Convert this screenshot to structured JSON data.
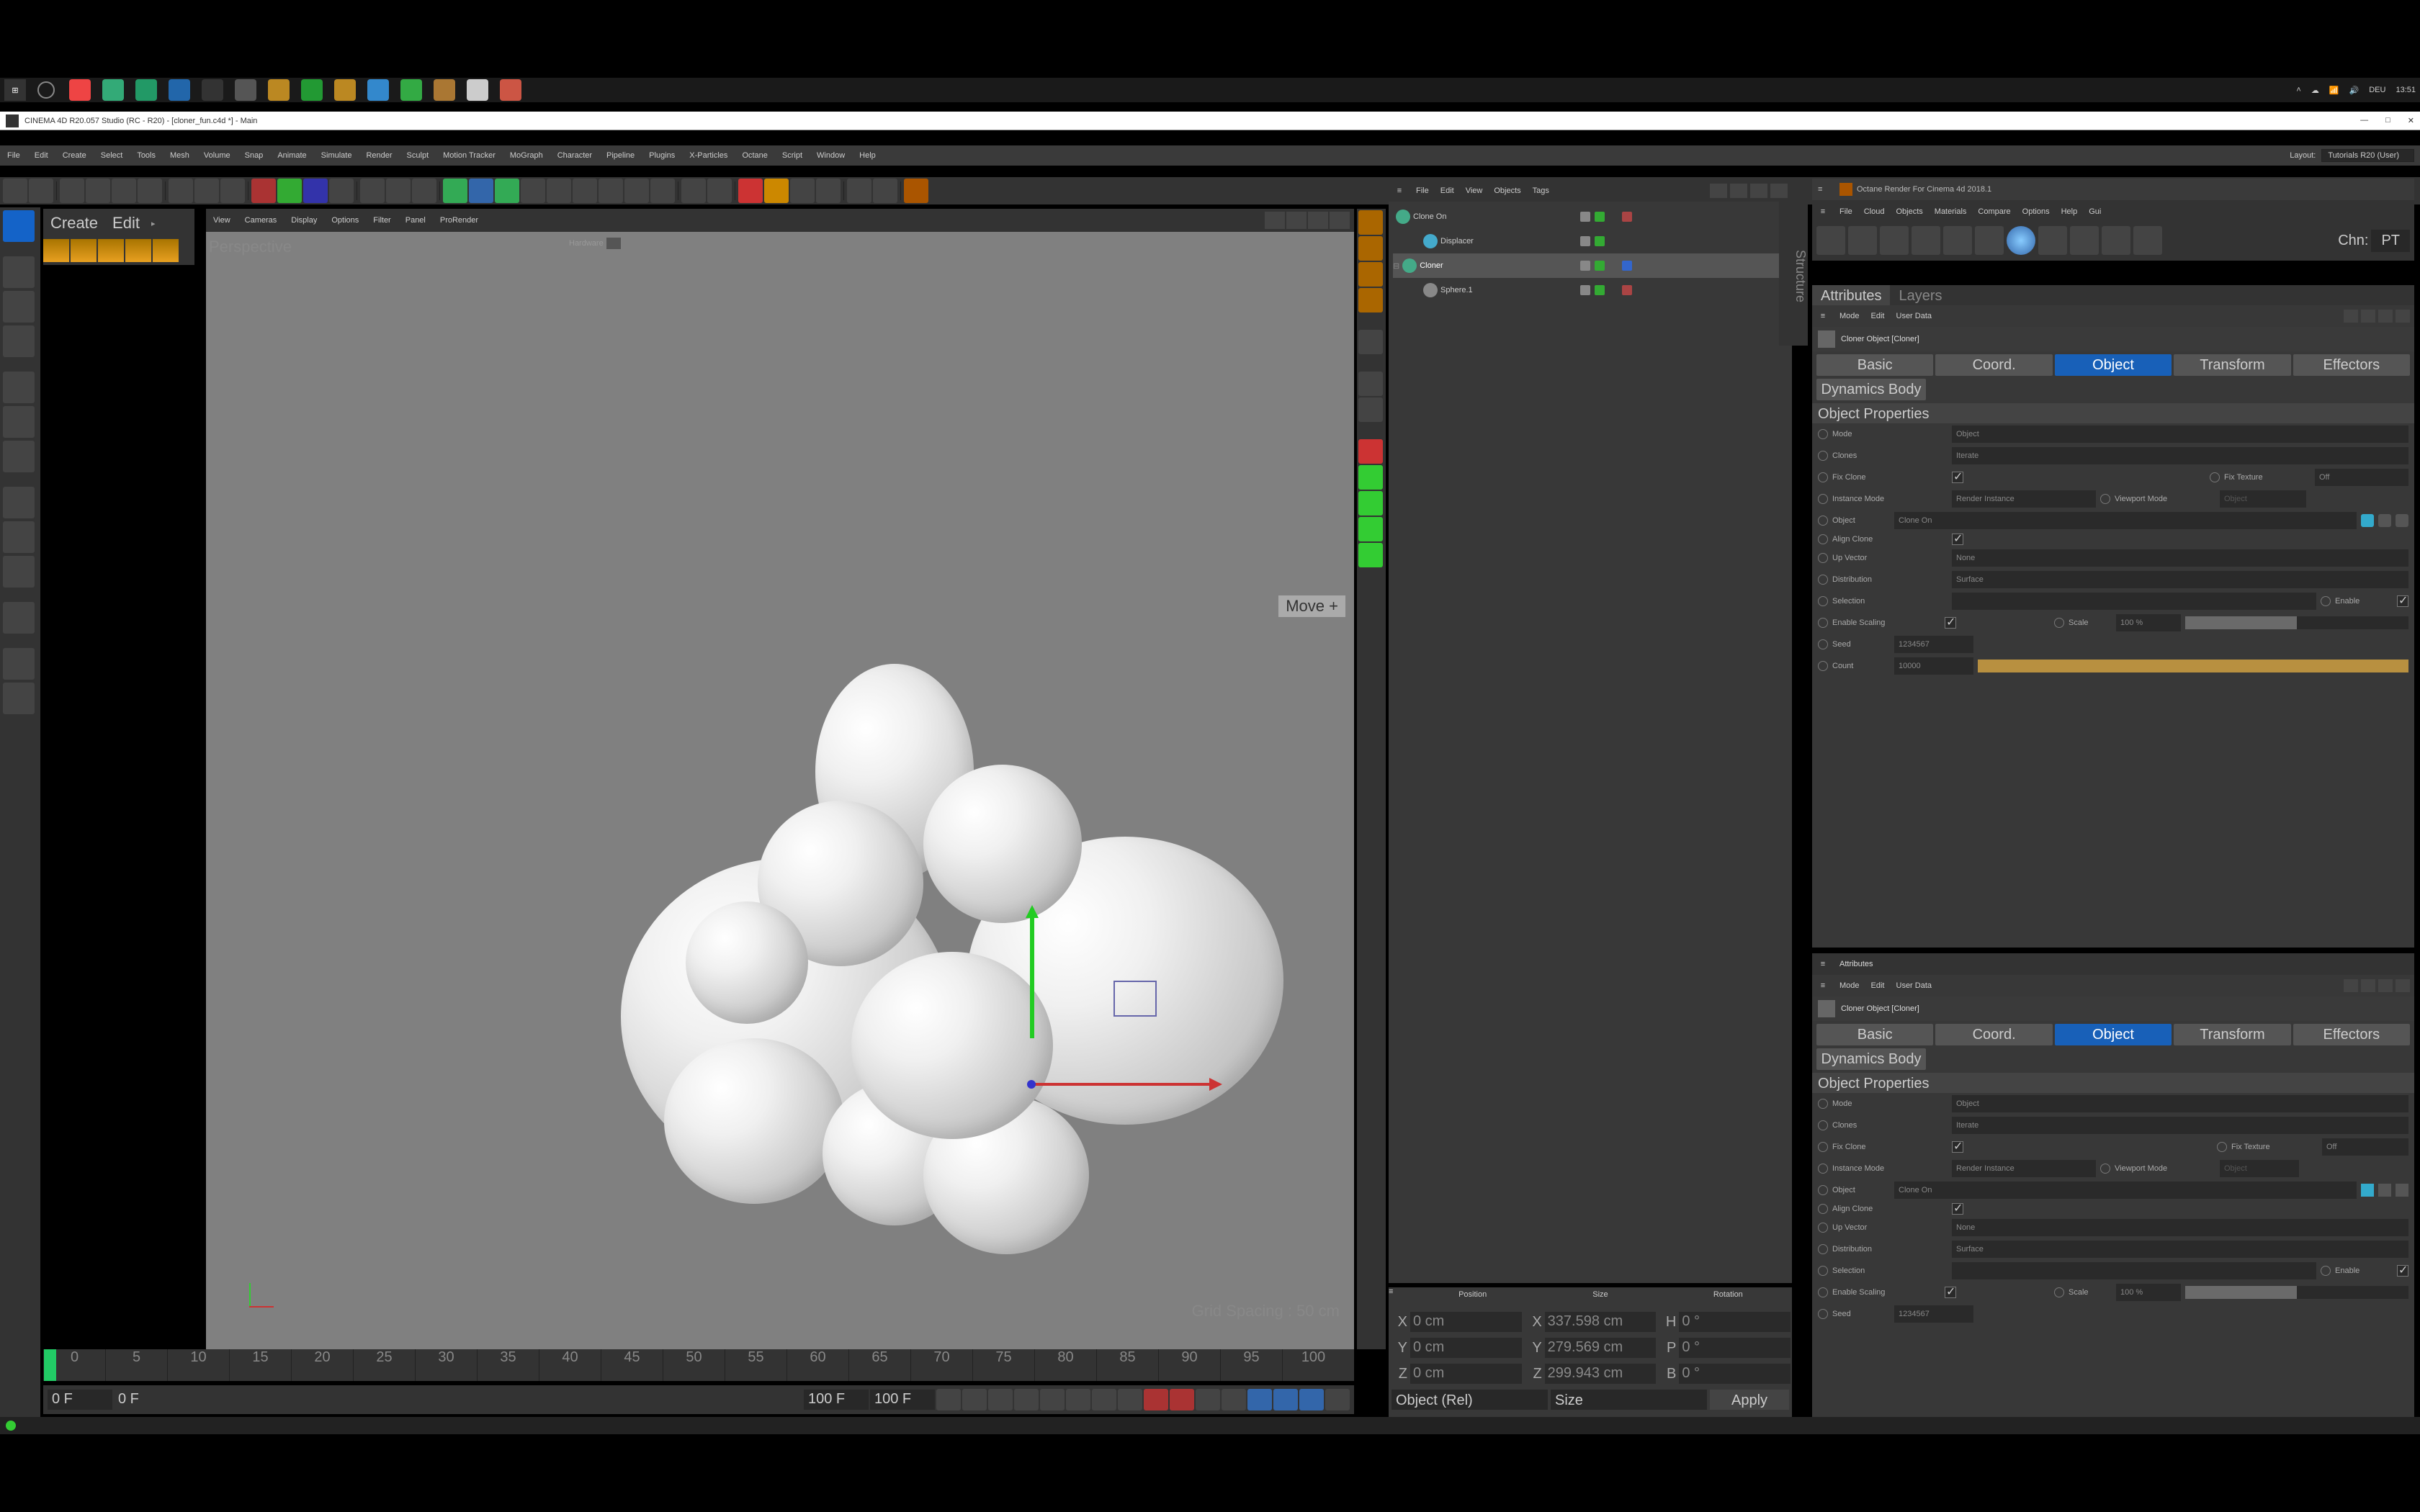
{
  "system": {
    "locale": "DEU",
    "clock": "13:51"
  },
  "titlebar": "CINEMA 4D R20.057 Studio (RC - R20) - [cloner_fun.c4d *] - Main",
  "layout_label": "Layout:",
  "layout_value": "Tutorials R20 (User)",
  "menu": [
    "File",
    "Edit",
    "Create",
    "Select",
    "Tools",
    "Mesh",
    "Volume",
    "Snap",
    "Animate",
    "Simulate",
    "Render",
    "Sculpt",
    "Motion Tracker",
    "MoGraph",
    "Character",
    "Pipeline",
    "Plugins",
    "X-Particles",
    "Octane",
    "Script",
    "Window",
    "Help"
  ],
  "mode_bar": {
    "create": "Create",
    "edit": "Edit"
  },
  "viewport_menu": [
    "View",
    "Cameras",
    "Display",
    "Options",
    "Filter",
    "Panel",
    "ProRender"
  ],
  "viewport": {
    "projection": "Perspective",
    "shader": "Hardware",
    "move_label": "Move  +",
    "grid_info": "Grid Spacing : 50 cm"
  },
  "objmgr": {
    "menu": [
      "File",
      "Edit",
      "View",
      "Objects",
      "Tags"
    ],
    "items": [
      {
        "name": "Clone On",
        "indent": 0,
        "icon": "g",
        "selected": false,
        "expander": ""
      },
      {
        "name": "Displacer",
        "indent": 1,
        "icon": "b",
        "selected": false,
        "expander": ""
      },
      {
        "name": "Cloner",
        "indent": 0,
        "icon": "g",
        "selected": true,
        "expander": "⊟"
      },
      {
        "name": "Sphere.1",
        "indent": 1,
        "icon": "gr",
        "selected": false,
        "expander": ""
      }
    ]
  },
  "structure_tab_label": "Structure",
  "octane": {
    "title": "Octane Render For Cinema 4d 2018.1",
    "menu": [
      "File",
      "Cloud",
      "Objects",
      "Materials",
      "Compare",
      "Options",
      "Help",
      "Gui"
    ],
    "chn_label": "Chn:",
    "chn_value": "PT"
  },
  "attrs_tabs": [
    "Attributes",
    "Layers"
  ],
  "attrs": {
    "menu": [
      "Mode",
      "Edit",
      "User Data"
    ],
    "header": "Cloner Object [Cloner]",
    "tabs": [
      "Basic",
      "Coord.",
      "Object",
      "Transform",
      "Effectors"
    ],
    "dyn_tab": "Dynamics Body",
    "active_tab": "Object",
    "section": "Object Properties",
    "rows": {
      "mode_label": "Mode",
      "mode_value": "Object",
      "clones_label": "Clones",
      "clones_value": "Iterate",
      "fixclone_label": "Fix Clone",
      "fixtexture_label": "Fix Texture",
      "fixtexture_value": "Off",
      "instmode_label": "Instance Mode",
      "instmode_value": "Render Instance",
      "vpmode_label": "Viewport Mode",
      "vpmode_value": "Object",
      "object_label": "Object",
      "object_value": "Clone On",
      "align_label": "Align Clone",
      "upvec_label": "Up Vector",
      "upvec_value": "None",
      "distrib_label": "Distribution",
      "distrib_value": "Surface",
      "selection_label": "Selection",
      "enable_label": "Enable",
      "scaling_label": "Enable Scaling",
      "scale_label": "Scale",
      "scale_value": "100 %",
      "seed_label": "Seed",
      "seed_value": "1234567",
      "count_label": "Count",
      "count_value": "10000"
    }
  },
  "coord": {
    "headers": [
      "Position",
      "Size",
      "Rotation"
    ],
    "rows": {
      "X": {
        "pos": "0 cm",
        "size": "337.598 cm",
        "rot_l": "H",
        "rot": "0 °"
      },
      "Y": {
        "pos": "0 cm",
        "size": "279.569 cm",
        "rot_l": "P",
        "rot": "0 °"
      },
      "Z": {
        "pos": "0 cm",
        "size": "299.943 cm",
        "rot_l": "B",
        "rot": "0 °"
      }
    },
    "sel1": "Object (Rel)",
    "sel2": "Size",
    "apply": "Apply"
  },
  "timeline": {
    "start": "0 F",
    "end": "100 F",
    "end2": "100 F",
    "ticks": [
      "0",
      "5",
      "10",
      "15",
      "20",
      "25",
      "30",
      "35",
      "40",
      "45",
      "50",
      "55",
      "60",
      "65",
      "70",
      "75",
      "80",
      "85",
      "90",
      "95",
      "100"
    ]
  }
}
